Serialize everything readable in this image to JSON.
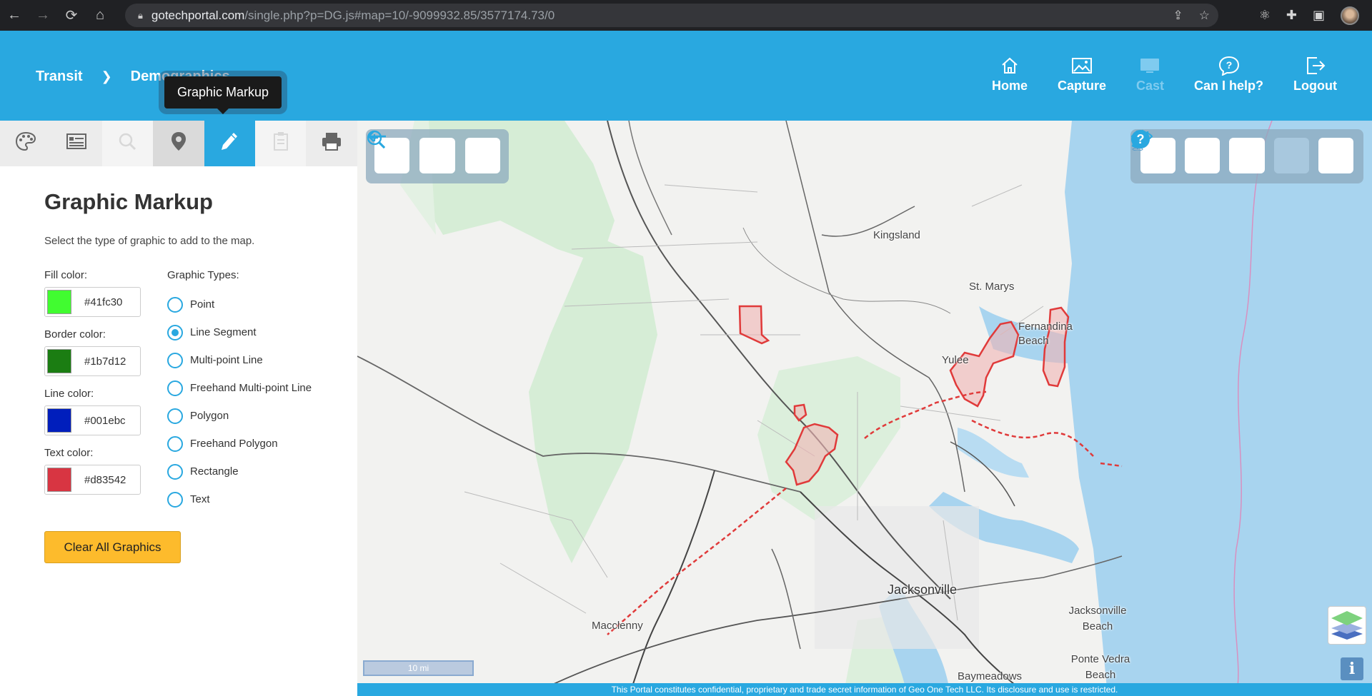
{
  "browser": {
    "url_host": "gotechportal.com",
    "url_path": "/single.php?p=DG.js#map=10/-9099932.85/3577174.73/0"
  },
  "header": {
    "breadcrumb": [
      "Transit",
      "Demographics"
    ],
    "nav": [
      {
        "label": "Home",
        "icon": "home-icon",
        "enabled": true
      },
      {
        "label": "Capture",
        "icon": "image-icon",
        "enabled": true
      },
      {
        "label": "Cast",
        "icon": "cast-icon",
        "enabled": false
      },
      {
        "label": "Can I help?",
        "icon": "help-bubble-icon",
        "enabled": true
      },
      {
        "label": "Logout",
        "icon": "logout-icon",
        "enabled": true
      }
    ]
  },
  "tooltip": "Graphic Markup",
  "tool_tabs": [
    {
      "icon": "palette-icon",
      "state": "normal"
    },
    {
      "icon": "legend-icon",
      "state": "normal"
    },
    {
      "icon": "search-icon",
      "state": "disabled"
    },
    {
      "icon": "map-pin-icon",
      "state": "dark"
    },
    {
      "icon": "pencil-icon",
      "state": "active"
    },
    {
      "icon": "clipboard-icon",
      "state": "disabled"
    },
    {
      "icon": "printer-icon",
      "state": "normal"
    }
  ],
  "panel": {
    "title": "Graphic Markup",
    "description": "Select the type of graphic to add to the map.",
    "colors": {
      "fill": {
        "label": "Fill color:",
        "value": "#41fc30"
      },
      "border": {
        "label": "Border color:",
        "value": "#1b7d12"
      },
      "line": {
        "label": "Line color:",
        "value": "#001ebc"
      },
      "text": {
        "label": "Text color:",
        "value": "#d83542"
      }
    },
    "types_label": "Graphic Types:",
    "types": [
      {
        "label": "Point",
        "checked": false
      },
      {
        "label": "Line Segment",
        "checked": true
      },
      {
        "label": "Multi-point Line",
        "checked": false
      },
      {
        "label": "Freehand Multi-point Line",
        "checked": false
      },
      {
        "label": "Polygon",
        "checked": false
      },
      {
        "label": "Freehand Polygon",
        "checked": false
      },
      {
        "label": "Rectangle",
        "checked": false
      },
      {
        "label": "Text",
        "checked": false
      }
    ],
    "clear_label": "Clear All Graphics"
  },
  "map": {
    "places": [
      "Kingsland",
      "St. Marys",
      "Fernandina Beach",
      "Yulee",
      "Jacksonville",
      "Macclenny",
      "Jacksonville Beach",
      "Ponte Vedra Beach",
      "Baymeadows"
    ],
    "scale": "10 mi",
    "footer": "This Portal constitutes confidential, proprietary and trade secret information of Geo One Tech LLC. Its disclosure and use is restricted.",
    "accent": "#29a8e0",
    "markup_color": "#e03a3a"
  }
}
